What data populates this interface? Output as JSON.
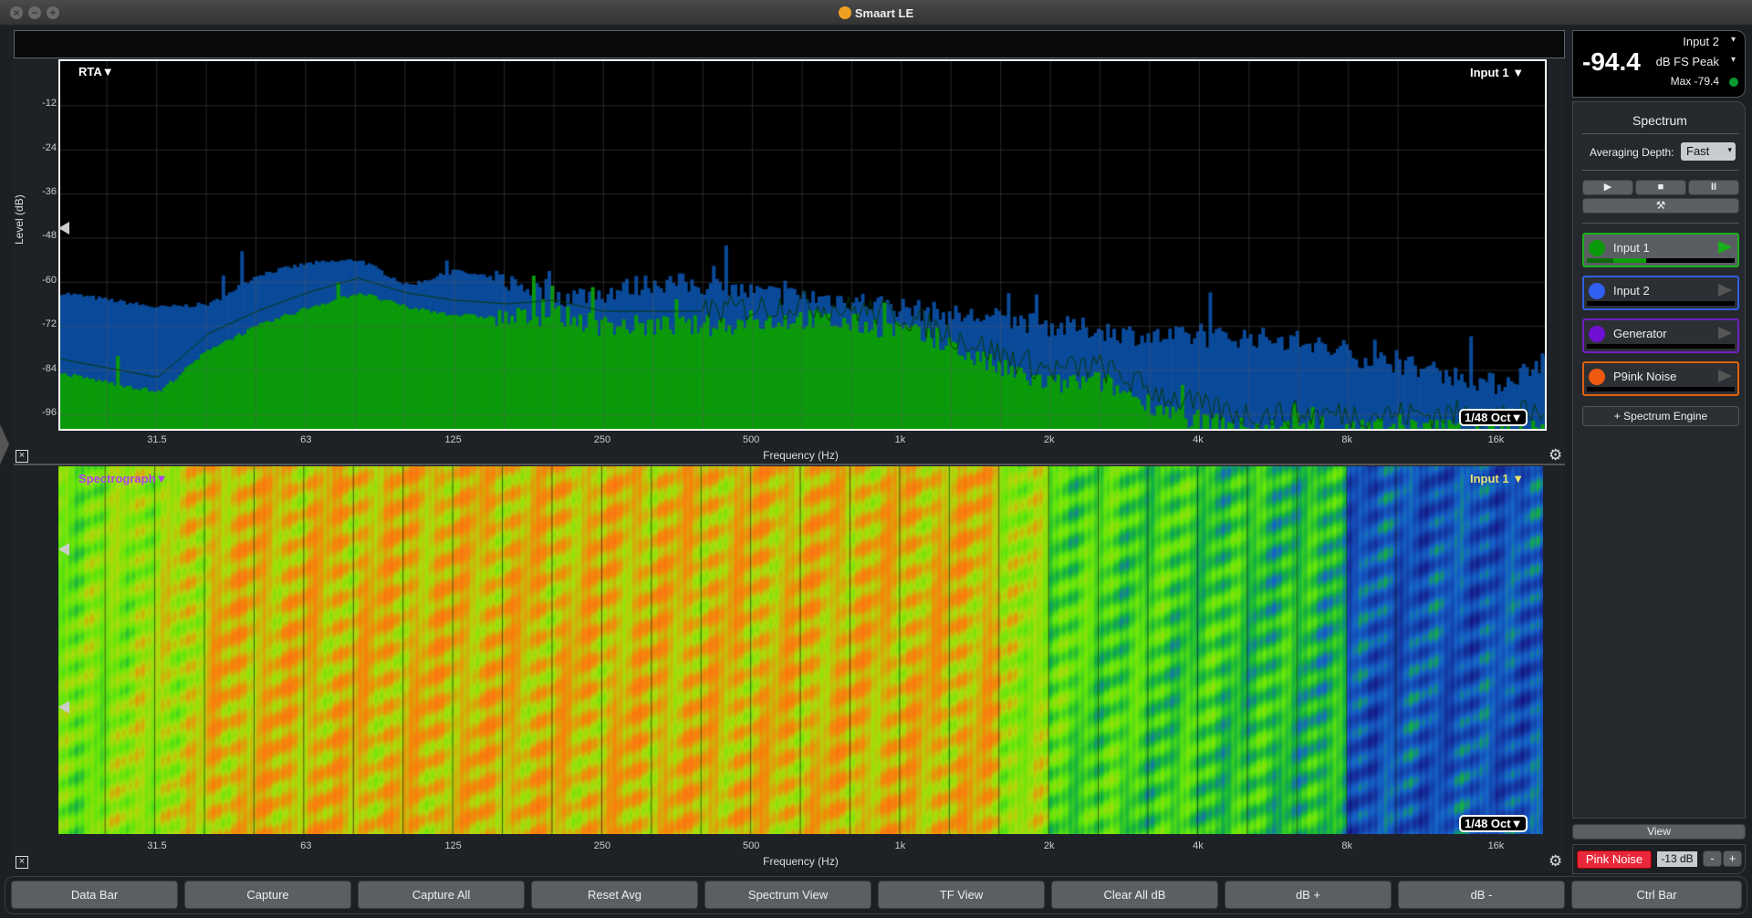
{
  "window": {
    "title": "Smaart LE"
  },
  "rta": {
    "mode_label": "RTA▼",
    "input_label": "Input 1 ▼",
    "resolution": "1/48 Oct▼",
    "ylabel": "Level (dB)",
    "xlabel": "Frequency (Hz)"
  },
  "spectrograph": {
    "mode_label": "Spectrograph▼",
    "input_label": "Input 1 ▼",
    "resolution": "1/48 Oct▼",
    "xlabel": "Frequency (Hz)"
  },
  "chart_data": {
    "type": "area",
    "xscale": "log",
    "xlim": [
      20,
      20000
    ],
    "ylim": [
      -100,
      0
    ],
    "grid": true,
    "xlabel": "Frequency (Hz)",
    "ylabel": "Level (dB)",
    "x_ticks": [
      "31.5",
      "63",
      "125",
      "250",
      "500",
      "1k",
      "2k",
      "4k",
      "8k",
      "16k"
    ],
    "x_tick_values": [
      31.5,
      63,
      125,
      250,
      500,
      1000,
      2000,
      4000,
      8000,
      16000
    ],
    "y_ticks": [
      -12,
      -24,
      -36,
      -48,
      -60,
      -72,
      -84,
      -96
    ],
    "series": [
      {
        "color": "#0a4a9a",
        "points": [
          [
            20,
            -63
          ],
          [
            31.5,
            -67
          ],
          [
            40,
            -66
          ],
          [
            50,
            -58
          ],
          [
            63,
            -55
          ],
          [
            80,
            -54
          ],
          [
            100,
            -61
          ],
          [
            125,
            -57
          ],
          [
            160,
            -60
          ],
          [
            200,
            -64
          ],
          [
            250,
            -63
          ],
          [
            315,
            -60
          ],
          [
            400,
            -61
          ],
          [
            500,
            -63
          ],
          [
            630,
            -64
          ],
          [
            800,
            -65
          ],
          [
            1000,
            -67
          ],
          [
            1250,
            -69
          ],
          [
            1600,
            -70
          ],
          [
            2000,
            -72
          ],
          [
            2500,
            -73
          ],
          [
            3150,
            -75
          ],
          [
            4000,
            -75
          ],
          [
            5000,
            -75
          ],
          [
            6300,
            -76
          ],
          [
            8000,
            -80
          ],
          [
            10000,
            -82
          ],
          [
            12500,
            -85
          ],
          [
            16000,
            -88
          ],
          [
            20000,
            -81
          ]
        ]
      },
      {
        "color": "#0a9a0a",
        "points": [
          [
            20,
            -85
          ],
          [
            31.5,
            -90
          ],
          [
            40,
            -78
          ],
          [
            50,
            -72
          ],
          [
            63,
            -67
          ],
          [
            80,
            -63
          ],
          [
            100,
            -67
          ],
          [
            125,
            -69
          ],
          [
            160,
            -70
          ],
          [
            200,
            -69
          ],
          [
            250,
            -72
          ],
          [
            400,
            -72
          ],
          [
            630,
            -70
          ],
          [
            1000,
            -73
          ],
          [
            1250,
            -78
          ],
          [
            1600,
            -84
          ],
          [
            2000,
            -88
          ],
          [
            2500,
            -87
          ],
          [
            3150,
            -93
          ],
          [
            4000,
            -98
          ],
          [
            5000,
            -100
          ],
          [
            20000,
            -100
          ]
        ]
      }
    ]
  },
  "meter": {
    "value": "-94.4",
    "source": "Input 2",
    "unit": "dB FS Peak",
    "max": "Max -79.4",
    "status_color": "#0a9a30"
  },
  "panel": {
    "title": "Spectrum",
    "avg_label": "Averaging Depth:",
    "avg_value": "Fast",
    "engines": [
      {
        "name": "Input 1",
        "color": "#0a9a0a",
        "border": "#1ab01a",
        "active": true,
        "level": 0.4
      },
      {
        "name": "Input 2",
        "color": "#3060f0",
        "border": "#3060e0",
        "active": false,
        "level": 0
      },
      {
        "name": "Generator",
        "color": "#7010d0",
        "border": "#7020c0",
        "active": false,
        "level": 0
      },
      {
        "name": "P9ink Noise",
        "color": "#f05a10",
        "border": "#e06010",
        "active": false,
        "level": 0
      }
    ],
    "add_engine": "+ Spectrum Engine",
    "view": "View"
  },
  "generator": {
    "label": "Pink Noise",
    "level": "-13 dB",
    "minus": "-",
    "plus": "+"
  },
  "toolbar": [
    "Data Bar",
    "Capture",
    "Capture All",
    "Reset Avg",
    "Spectrum View",
    "TF View",
    "Clear All dB",
    "dB +",
    "dB -",
    "Ctrl Bar"
  ]
}
